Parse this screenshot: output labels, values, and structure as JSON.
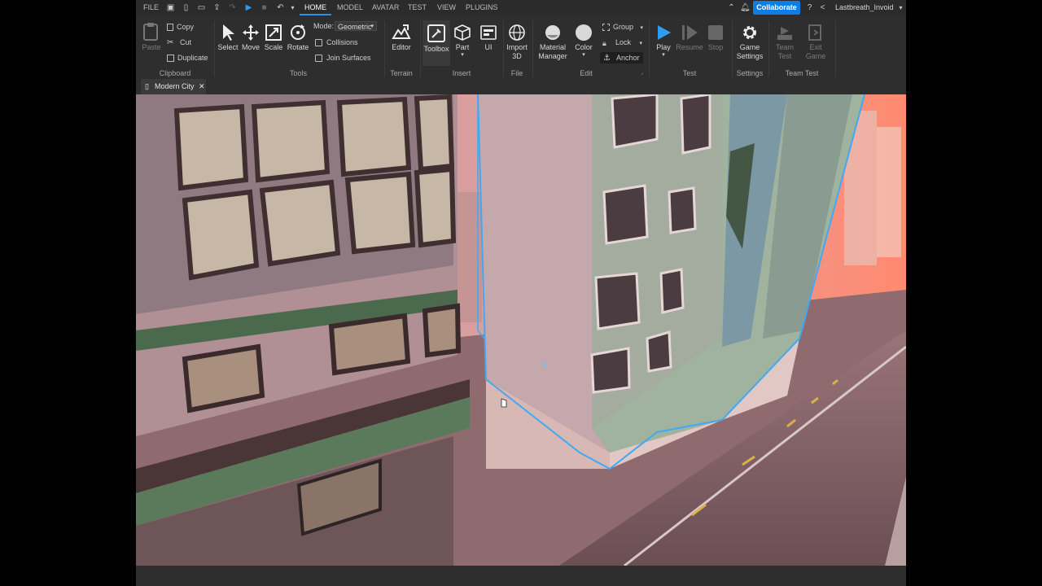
{
  "menubar": {
    "file": "FILE",
    "tabs": [
      "HOME",
      "MODEL",
      "AVATAR",
      "TEST",
      "VIEW",
      "PLUGINS"
    ],
    "active_tab": "HOME",
    "collaborate": "Collaborate",
    "username": "Lastbreath_Invoid"
  },
  "ribbon": {
    "clipboard": {
      "paste": "Paste",
      "copy": "Copy",
      "cut": "Cut",
      "duplicate": "Duplicate",
      "label": "Clipboard"
    },
    "tools": {
      "select": "Select",
      "move": "Move",
      "scale": "Scale",
      "rotate": "Rotate",
      "mode_label": "Mode:",
      "mode_value": "Geometric",
      "collisions": "Collisions",
      "join_surfaces": "Join Surfaces",
      "label": "Tools"
    },
    "terrain": {
      "editor": "Editor",
      "label": "Terrain"
    },
    "insert": {
      "toolbox": "Toolbox",
      "part": "Part",
      "ui": "UI",
      "label": "Insert"
    },
    "file": {
      "import_line1": "Import",
      "import_line2": "3D",
      "label": "File"
    },
    "edit": {
      "material_line1": "Material",
      "material_line2": "Manager",
      "color": "Color",
      "group": "Group",
      "lock": "Lock",
      "anchor": "Anchor",
      "label": "Edit"
    },
    "test": {
      "play": "Play",
      "resume": "Resume",
      "stop": "Stop",
      "label": "Test"
    },
    "settings": {
      "game_line1": "Game",
      "game_line2": "Settings",
      "label": "Settings"
    },
    "team_test": {
      "team_line1": "Team",
      "team_line2": "Test",
      "exit_line1": "Exit",
      "exit_line2": "Game",
      "label": "Team Test"
    }
  },
  "document_tab": {
    "title": "Modern City"
  },
  "colors": {
    "accent": "#0f7de6",
    "selection_outline": "#3fa9f5",
    "play": "#2f9cf0"
  }
}
